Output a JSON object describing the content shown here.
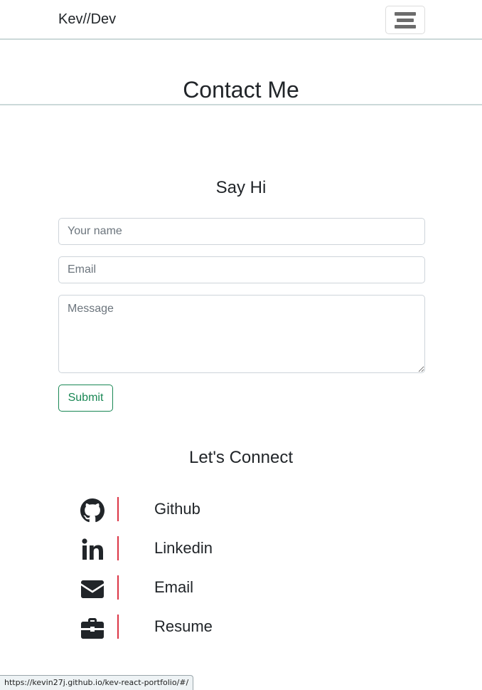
{
  "navbar": {
    "brand": "Kev//Dev",
    "toggler_icon": "hamburger-icon"
  },
  "page": {
    "title": "Contact Me"
  },
  "form": {
    "heading": "Say Hi",
    "name_placeholder": "Your name",
    "email_placeholder": "Email",
    "message_placeholder": "Message",
    "name_value": "",
    "email_value": "",
    "message_value": "",
    "submit_label": "Submit",
    "submit_color": "#198754"
  },
  "connect": {
    "heading": "Let's Connect",
    "divider_color": "#dc3545",
    "items": [
      {
        "label": "Github",
        "icon": "github-icon"
      },
      {
        "label": "Linkedin",
        "icon": "linkedin-icon"
      },
      {
        "label": "Email",
        "icon": "envelope-icon"
      },
      {
        "label": "Resume",
        "icon": "briefcase-icon"
      }
    ]
  },
  "status_bar": {
    "url": "https://kevin27j.github.io/kev-react-portfolio/#/"
  }
}
